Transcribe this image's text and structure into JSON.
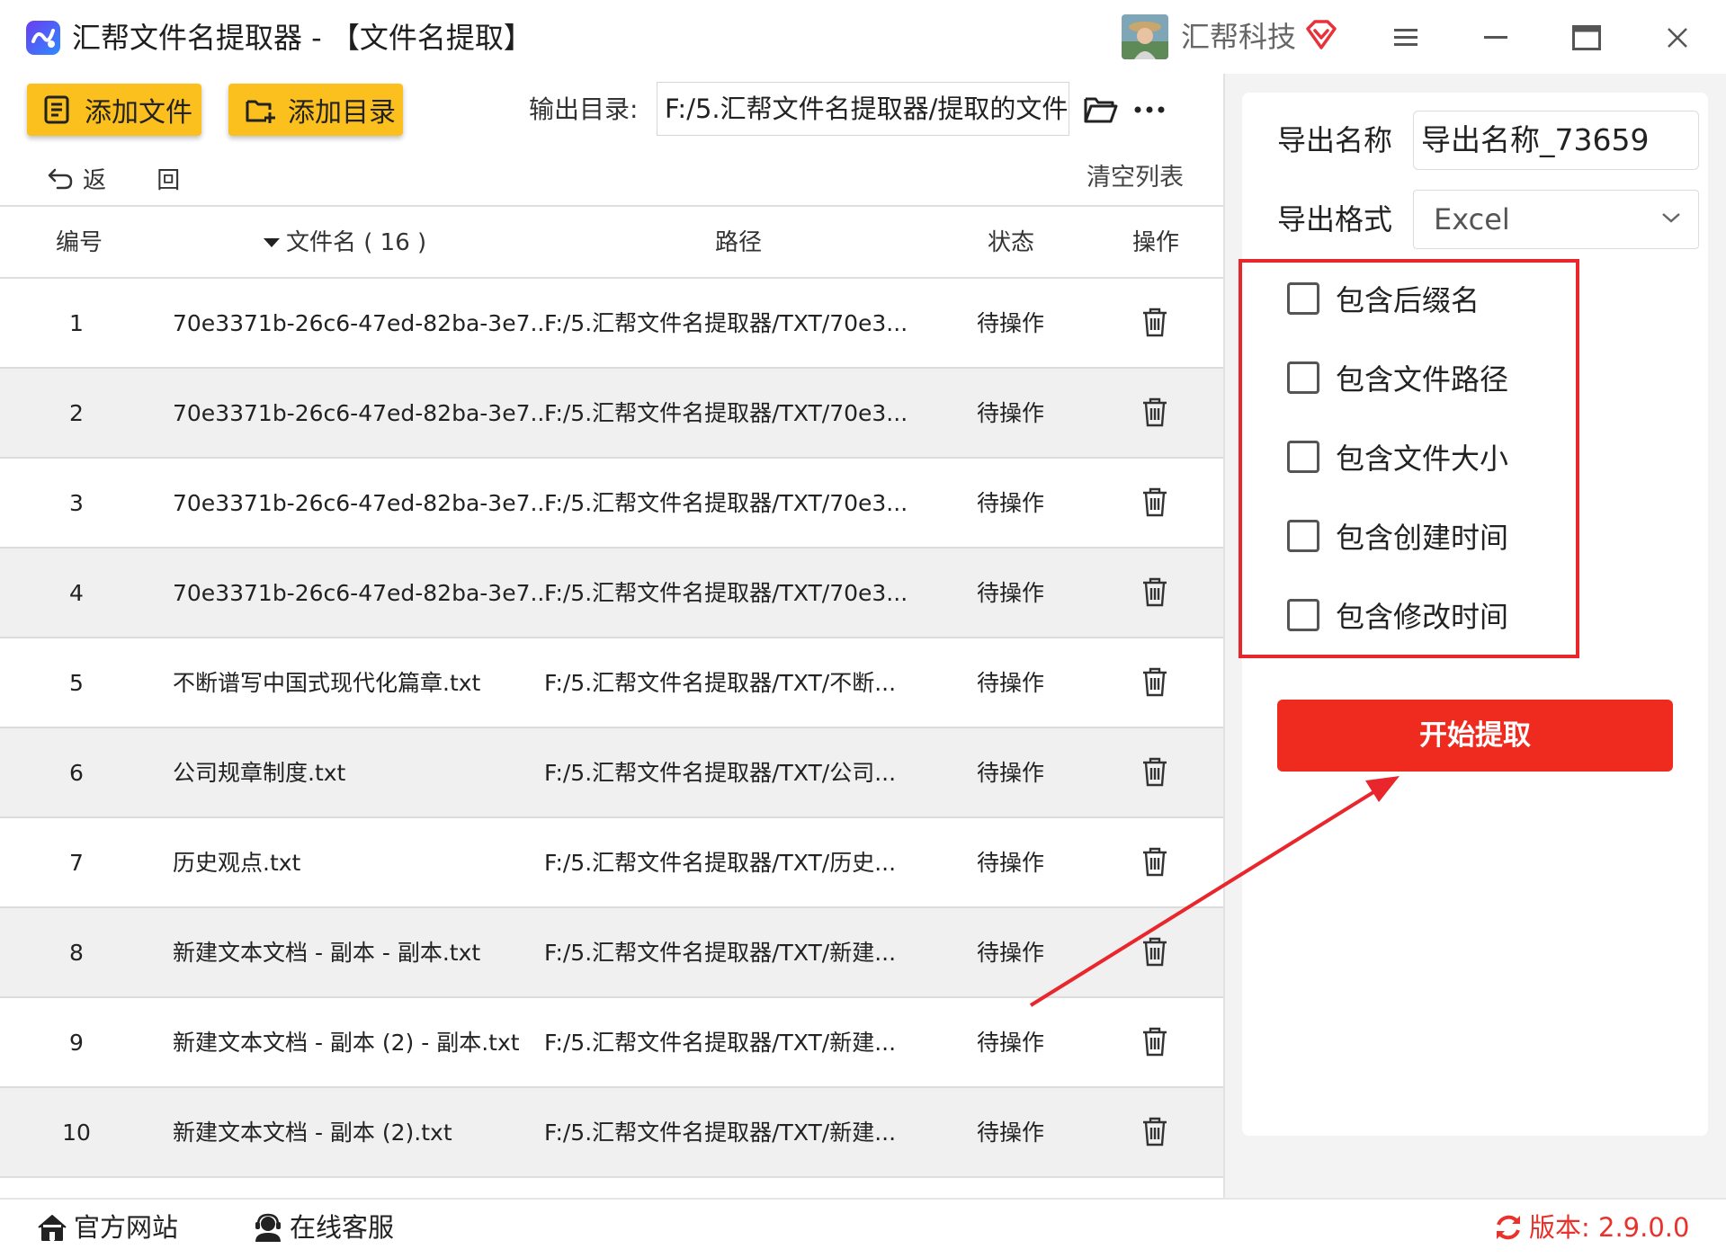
{
  "window": {
    "title": "汇帮文件名提取器 - 【文件名提取】",
    "company": "汇帮科技"
  },
  "toolbar": {
    "add_file_label": "添加文件",
    "add_folder_label": "添加目录",
    "output_dir_label": "输出目录:",
    "output_dir_value": "F:/5.汇帮文件名提取器/提取的文件",
    "back_label": "返 回",
    "clear_list_label": "清空列表"
  },
  "table": {
    "headers": {
      "number": "编号",
      "filename": "文件名 ( 16 )",
      "path": "路径",
      "status": "状态",
      "action": "操作"
    },
    "rows": [
      {
        "num": "1",
        "name": "70e3371b-26c6-47ed-82ba-3e7...",
        "path": "F:/5.汇帮文件名提取器/TXT/70e3...",
        "status": "待操作"
      },
      {
        "num": "2",
        "name": "70e3371b-26c6-47ed-82ba-3e7...",
        "path": "F:/5.汇帮文件名提取器/TXT/70e3...",
        "status": "待操作"
      },
      {
        "num": "3",
        "name": "70e3371b-26c6-47ed-82ba-3e7...",
        "path": "F:/5.汇帮文件名提取器/TXT/70e3...",
        "status": "待操作"
      },
      {
        "num": "4",
        "name": "70e3371b-26c6-47ed-82ba-3e7...",
        "path": "F:/5.汇帮文件名提取器/TXT/70e3...",
        "status": "待操作"
      },
      {
        "num": "5",
        "name": "不断谱写中国式现代化篇章.txt",
        "path": "F:/5.汇帮文件名提取器/TXT/不断...",
        "status": "待操作"
      },
      {
        "num": "6",
        "name": "公司规章制度.txt",
        "path": "F:/5.汇帮文件名提取器/TXT/公司...",
        "status": "待操作"
      },
      {
        "num": "7",
        "name": "历史观点.txt",
        "path": "F:/5.汇帮文件名提取器/TXT/历史...",
        "status": "待操作"
      },
      {
        "num": "8",
        "name": "新建文本文档 - 副本 - 副本.txt",
        "path": "F:/5.汇帮文件名提取器/TXT/新建...",
        "status": "待操作"
      },
      {
        "num": "9",
        "name": "新建文本文档 - 副本 (2) - 副本.txt",
        "path": "F:/5.汇帮文件名提取器/TXT/新建...",
        "status": "待操作"
      },
      {
        "num": "10",
        "name": "新建文本文档 - 副本 (2).txt",
        "path": "F:/5.汇帮文件名提取器/TXT/新建...",
        "status": "待操作"
      }
    ]
  },
  "settings": {
    "export_name_label": "导出名称",
    "export_name_value": "导出名称_73659",
    "export_format_label": "导出格式",
    "export_format_value": "Excel",
    "options": [
      {
        "label": "包含后缀名",
        "checked": false
      },
      {
        "label": "包含文件路径",
        "checked": false
      },
      {
        "label": "包含文件大小",
        "checked": false
      },
      {
        "label": "包含创建时间",
        "checked": false
      },
      {
        "label": "包含修改时间",
        "checked": false
      }
    ],
    "start_label": "开始提取"
  },
  "footer": {
    "website_label": "官方网站",
    "support_label": "在线客服",
    "version_label": "版本:  2.9.0.0"
  },
  "colors": {
    "accent_yellow": "#fbc01d",
    "start_red": "#ef2a1e",
    "highlight_red": "#e8262b",
    "version_red": "#e8322b"
  }
}
